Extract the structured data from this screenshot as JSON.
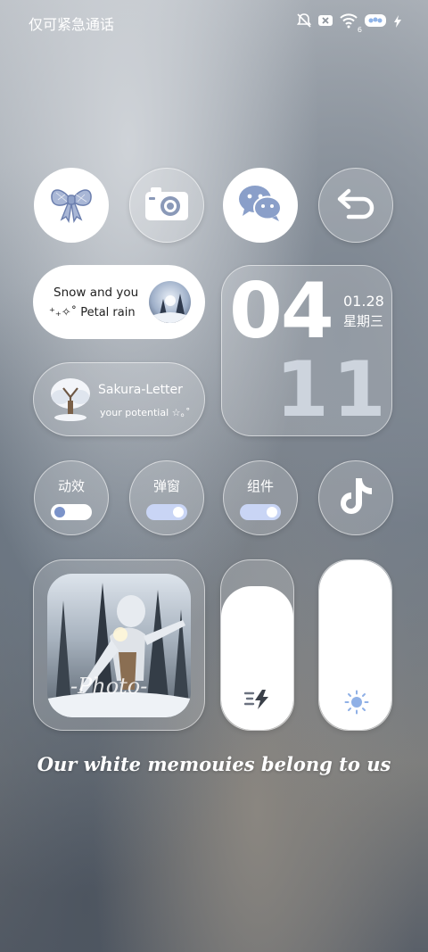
{
  "status_bar": {
    "carrier_text": "仅可紧急通话",
    "icons": [
      "bell-off-icon",
      "no-sim-icon",
      "wifi-icon",
      "battery-icon",
      "charging-icon"
    ],
    "wifi_badge": "6"
  },
  "apps": {
    "bow": {
      "icon": "bow-icon"
    },
    "camera": {
      "icon": "camera-icon"
    },
    "wechat": {
      "icon": "wechat-icon"
    },
    "back": {
      "icon": "back-arrow-icon"
    }
  },
  "snow_widget": {
    "line1": "Snow and you",
    "line2": "⁺₊✧˚ Petal rain"
  },
  "sakura_widget": {
    "title": "Sakura-Letter",
    "subtitle": "your potential ☆｡˚"
  },
  "clock": {
    "hour": "04",
    "minute": "11",
    "date": "01.28",
    "weekday": "星期三"
  },
  "toggles": {
    "animation": {
      "label": "动效",
      "on": false
    },
    "popup": {
      "label": "弹窗",
      "on": true
    },
    "widget": {
      "label": "组件",
      "on": true
    }
  },
  "tiktok": {
    "icon": "tiktok-icon"
  },
  "photo_widget": {
    "caption": "-Photo-"
  },
  "sliders": {
    "power": {
      "icon": "flash-icon",
      "level": 0.85
    },
    "brightness": {
      "icon": "sun-icon",
      "level": 1.0
    }
  },
  "footer_text": "Our white memouies belong to us",
  "colors": {
    "accent": "#7b93c9",
    "toggle_on": "#c9d5f5",
    "white": "#ffffff"
  }
}
